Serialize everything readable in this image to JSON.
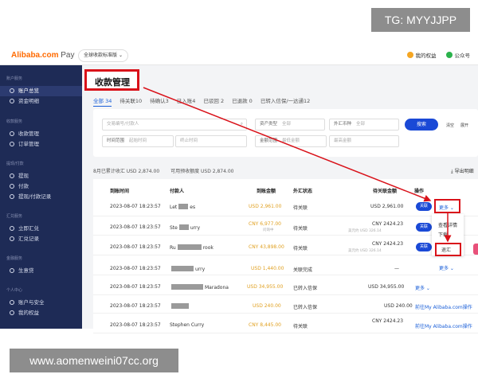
{
  "watermarks": {
    "tg": "TG: MYYJJPP",
    "url": "www.aomenweini07cc.org"
  },
  "header": {
    "logo_brand": "Alibaba.com",
    "logo_product": "Pay",
    "edition": "全球收款标准版",
    "right_items": [
      "我的权益",
      "公众号"
    ]
  },
  "sidebar": {
    "groups": [
      {
        "label": "账户服务",
        "items": [
          "账户总览",
          "资金明细"
        ]
      },
      {
        "label": "收款服务",
        "items": [
          "收款管理",
          "订单管理"
        ]
      },
      {
        "label": "提现/付款",
        "items": [
          "提现",
          "付款",
          "提现/付款记录"
        ]
      },
      {
        "label": "汇兑服务",
        "items": [
          "立即汇兑",
          "汇兑记录"
        ]
      },
      {
        "label": "金融服务",
        "items": [
          "生意贷"
        ]
      },
      {
        "label": "个人中心",
        "items": [
          "账户与安全",
          "我的权益"
        ]
      }
    ],
    "active_item": "收款管理"
  },
  "page": {
    "title": "收款管理",
    "tabs": [
      "全部 34",
      "待关联10",
      "待确认3",
      "已入账4",
      "已驳回 2",
      "已退款 0",
      "已转入信保/一达通12"
    ]
  },
  "filters": {
    "row1": [
      {
        "label": "",
        "placeholder": "交易编号/付款人"
      },
      {
        "label": "资产类型",
        "placeholder": "全部"
      },
      {
        "label": "外汇币种",
        "placeholder": "全部"
      }
    ],
    "row2": [
      {
        "label": "时间范围",
        "placeholder": "起始时间"
      },
      {
        "label": "",
        "placeholder": "终止时间"
      },
      {
        "label": "金额范围",
        "placeholder": "最低金额"
      },
      {
        "label": "",
        "placeholder": "最高金额"
      }
    ],
    "search_label": "搜索",
    "extra": [
      "清空",
      "展开"
    ]
  },
  "summary": {
    "month_total": "8月已累计收汇 USD 2,874.00",
    "available_quota": "可用预收额度 USD 2,874.00",
    "export": "导出明细"
  },
  "table": {
    "headers": [
      "到账时间",
      "付款人",
      "到账金额",
      "外汇状态",
      "待关联金额",
      "操作"
    ],
    "rows": [
      {
        "time": "2023-08-07 18:23:57",
        "payer_pre": "Let",
        "payer_post": "es",
        "amount": "USD 2,961.00",
        "amount_sub": "",
        "status": "待关联",
        "pending": "USD 2,961.00",
        "pending_sub": "",
        "action": "关联",
        "more": "更多"
      },
      {
        "time": "2023-08-07 18:23:57",
        "payer_pre": "Ste",
        "payer_post": "urry",
        "amount": "CNY 6,977.00",
        "amount_sub": "问询中",
        "status": "待关联",
        "pending": "CNY 2424.23",
        "pending_sub": "美元约 USD 326.14",
        "action": "关联",
        "more": ""
      },
      {
        "time": "2023-08-07 18:23:57",
        "payer_pre": "Ru",
        "payer_post": "rook",
        "amount": "CNY 43,898.00",
        "amount_sub": "",
        "status": "待关联",
        "pending": "CNY 2424.23",
        "pending_sub": "美元约 USD 326.14",
        "action": "关联",
        "more": "更多"
      },
      {
        "time": "2023-08-07 18:23:57",
        "payer_pre": "",
        "payer_post": "urry",
        "amount": "USD 1,440.00",
        "amount_sub": "",
        "status": "关联完成",
        "pending": "—",
        "pending_sub": "",
        "action": "",
        "more": "更多"
      },
      {
        "time": "2023-08-07 18:23:57",
        "payer_pre": "",
        "payer_post": "Maradona",
        "amount": "USD 34,955.00",
        "amount_sub": "",
        "status": "已转入信保",
        "pending": "USD 34,955.00",
        "pending_sub": "",
        "action": "",
        "more": "更多"
      },
      {
        "time": "2023-08-07 18:23:57",
        "payer_pre": "",
        "payer_post": "",
        "amount": "USD 240.00",
        "amount_sub": "",
        "status": "已转入信保",
        "pending": "USD 240.00",
        "pending_sub": "",
        "action": "",
        "more": "前往My Alibaba.com操作"
      },
      {
        "time": "2023-08-07 18:23:57",
        "payer_pre": "Stephen Curry",
        "payer_post": "",
        "amount": "CNY 8,445.00",
        "amount_sub": "",
        "status": "待关联",
        "pending": "CNY 2424.23",
        "pending_sub": "",
        "action": "",
        "more": "前往My Alibaba.com操作"
      }
    ]
  },
  "dropdown": {
    "items": [
      "查看详情",
      "下载",
      "退汇"
    ],
    "highlight": "退汇"
  },
  "colors": {
    "accent": "#1a49d6",
    "annotation": "#d9121a",
    "sidebar": "#1e2b56",
    "amount": "#e0a020"
  }
}
